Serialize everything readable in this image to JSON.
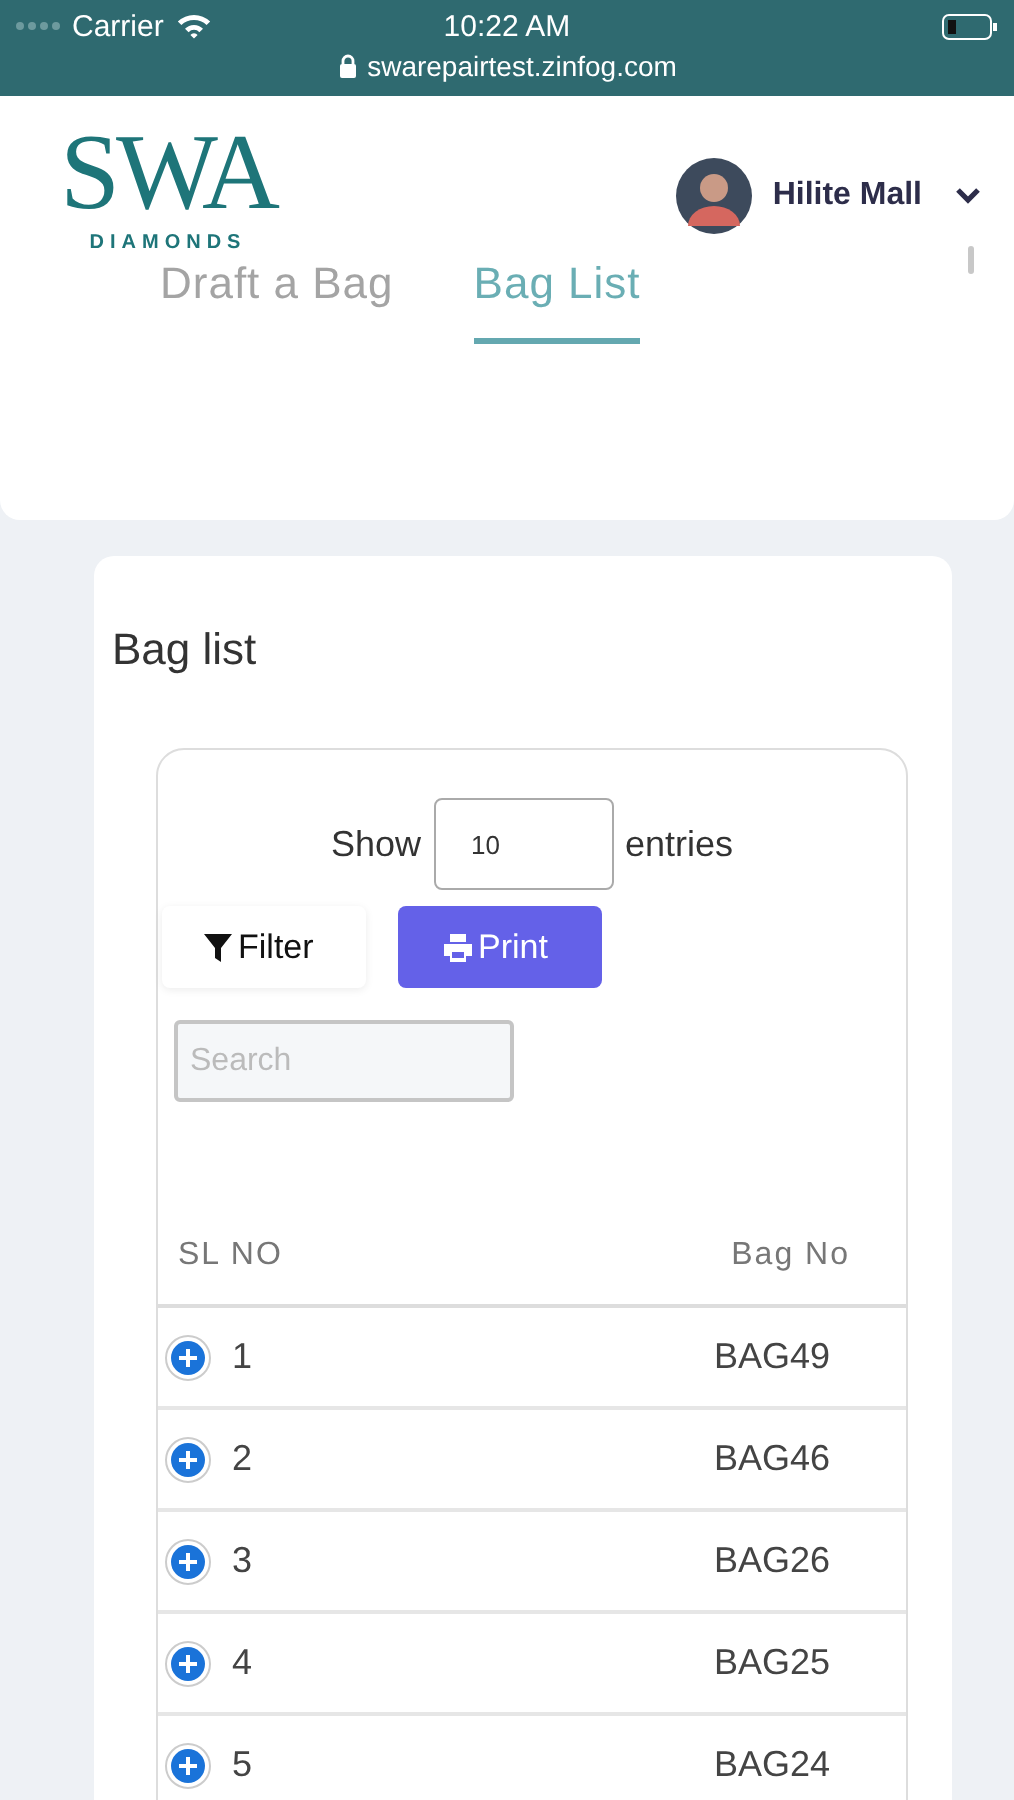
{
  "status_bar": {
    "carrier": "Carrier",
    "time": "10:22 AM",
    "url": "swarepairtest.zinfog.com"
  },
  "logo": {
    "mark": "SWA",
    "subtitle": "DIAMONDS"
  },
  "user": {
    "name": "Hilite Mall"
  },
  "tabs": [
    {
      "label": "Draft a Bag",
      "selected": false
    },
    {
      "label": "Bag List",
      "selected": true
    }
  ],
  "card": {
    "title": "Bag list"
  },
  "length_menu": {
    "before": "Show",
    "value": "10",
    "after": "entries"
  },
  "buttons": [
    {
      "kind": "filter",
      "label": "Filter"
    },
    {
      "kind": "print",
      "label": "Print"
    }
  ],
  "search": {
    "placeholder": "Search"
  },
  "table": {
    "columns": [
      "SL NO",
      "Bag No"
    ],
    "rows": [
      {
        "sl": "1",
        "bag": "BAG49"
      },
      {
        "sl": "2",
        "bag": "BAG46"
      },
      {
        "sl": "3",
        "bag": "BAG26"
      },
      {
        "sl": "4",
        "bag": "BAG25"
      },
      {
        "sl": "5",
        "bag": "BAG24"
      }
    ]
  }
}
